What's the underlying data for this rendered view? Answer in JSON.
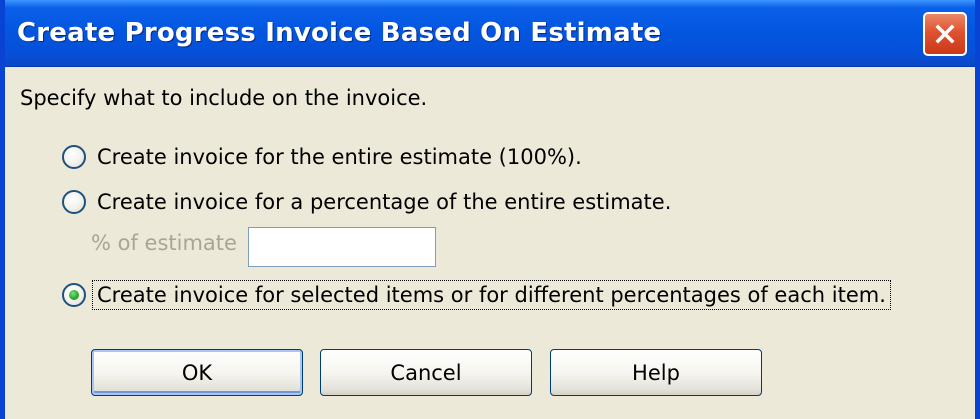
{
  "window": {
    "title": "Create Progress Invoice Based On Estimate"
  },
  "dialog": {
    "instruction": "Specify what to include on the invoice.",
    "options": [
      {
        "label": "Create invoice for the entire estimate (100%).",
        "selected": false
      },
      {
        "label": "Create invoice for a percentage of the entire estimate.",
        "selected": false
      },
      {
        "label": "Create invoice for selected items or for different percentages of each item.",
        "selected": true
      }
    ],
    "percent_field": {
      "label": "% of estimate",
      "value": "",
      "enabled": false
    }
  },
  "buttons": {
    "ok": "OK",
    "cancel": "Cancel",
    "help": "Help"
  },
  "colors": {
    "titlebar": "#0356e0",
    "close_button": "#e0522f",
    "dialog_background": "#ece9d8",
    "disabled_text": "#a7a597",
    "radio_selected_dot": "#2aa52a"
  },
  "icons": {
    "close": "close-x-icon"
  }
}
